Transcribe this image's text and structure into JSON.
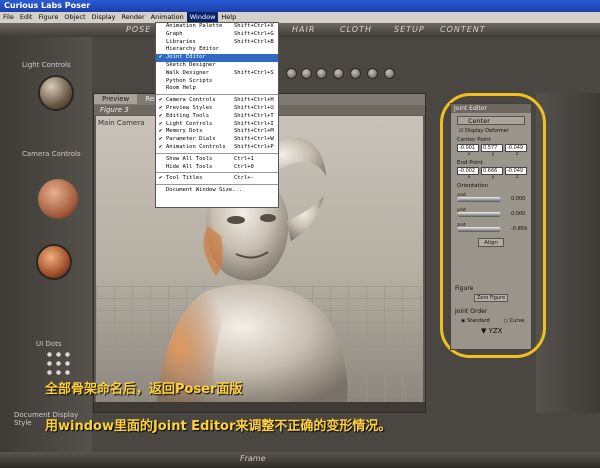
{
  "window": {
    "title": "Curious Labs Poser"
  },
  "menubar": [
    "File",
    "Edit",
    "Figure",
    "Object",
    "Display",
    "Render",
    "Animation",
    "Window",
    "Help"
  ],
  "tabs": [
    "POSE",
    "HAIR",
    "CLOTH",
    "SETUP",
    "CONTENT"
  ],
  "left_panel": {
    "light_controls": "Light Controls",
    "camera_controls": "Camera Controls",
    "ui_dots": "UI Dots",
    "doc_display_style": "Document Display Style"
  },
  "document": {
    "tabs": [
      "Preview",
      "Render"
    ],
    "figure_selector": "Figure 3",
    "camera_label": "Main Camera"
  },
  "window_menu": {
    "items": [
      {
        "label": "Animation Palette",
        "shortcut": "Shift+Ctrl+V",
        "checked": false
      },
      {
        "label": "Graph",
        "shortcut": "Shift+Ctrl+G",
        "checked": false
      },
      {
        "label": "Libraries",
        "shortcut": "Shift+Ctrl+B",
        "checked": false
      },
      {
        "label": "Hierarchy Editor",
        "shortcut": "",
        "checked": false
      },
      {
        "label": "Joint Editor",
        "shortcut": "",
        "checked": true,
        "highlighted": true
      },
      {
        "label": "Sketch Designer",
        "shortcut": "",
        "checked": false
      },
      {
        "label": "Walk Designer",
        "shortcut": "Shift+Ctrl+S",
        "checked": false
      },
      {
        "label": "Python Scripts",
        "shortcut": "",
        "checked": false
      },
      {
        "label": "Room Help",
        "shortcut": "",
        "checked": false
      },
      {
        "sep": true
      },
      {
        "label": "Camera Controls",
        "shortcut": "Shift+Ctrl+H",
        "checked": true
      },
      {
        "label": "Preview Styles",
        "shortcut": "Shift+Ctrl+U",
        "checked": true
      },
      {
        "label": "Editing Tools",
        "shortcut": "Shift+Ctrl+T",
        "checked": true
      },
      {
        "label": "Light Controls",
        "shortcut": "Shift+Ctrl+I",
        "checked": true
      },
      {
        "label": "Memory Dots",
        "shortcut": "Shift+Ctrl+M",
        "checked": true
      },
      {
        "label": "Parameter Dials",
        "shortcut": "Shift+Ctrl+W",
        "checked": true
      },
      {
        "label": "Animation Controls",
        "shortcut": "Shift+Ctrl+P",
        "checked": true
      },
      {
        "sep": true
      },
      {
        "label": "Show All Tools",
        "shortcut": "Ctrl+1",
        "checked": false
      },
      {
        "label": "Hide All Tools",
        "shortcut": "Ctrl+0",
        "checked": false
      },
      {
        "sep": true
      },
      {
        "label": "Tool Titles",
        "shortcut": "Ctrl+-",
        "checked": true
      },
      {
        "sep": true
      },
      {
        "label": "Document Window Size...",
        "shortcut": "",
        "checked": false
      }
    ]
  },
  "joint_editor": {
    "title": "Joint Editor",
    "dropdown": "Center",
    "display_deformer": "Display Deformer",
    "center_point_label": "Center Point",
    "center_point": [
      "-0.001",
      "0.577",
      "-0.049"
    ],
    "end_point_label": "End Point",
    "end_point": [
      "-0.002",
      "0.666",
      "-0.049"
    ],
    "axes": [
      "x",
      "y",
      "z"
    ],
    "orientation_label": "Orientation",
    "sliders": [
      {
        "name": "xrot",
        "value": "0.000"
      },
      {
        "name": "yrot",
        "value": "0.000"
      },
      {
        "name": "zrot",
        "value": "-0.859"
      }
    ],
    "align_button": "Align",
    "figure_label": "Figure",
    "zero_figure_button": "Zero Figure",
    "joint_order_label": "Joint Order",
    "standard": "Standard",
    "curve": "Curve",
    "order": "YZX"
  },
  "captions": {
    "line1": "全部骨架命名后，返回Poser面版",
    "line2": "用window里面的Joint Editor来调整不正确的变形情况。"
  },
  "bottom": {
    "frame_label": "Frame"
  },
  "colors": {
    "highlight_oval": "#f0c020",
    "caption": "#ffd23c",
    "menu_highlight": "#316ac5"
  }
}
